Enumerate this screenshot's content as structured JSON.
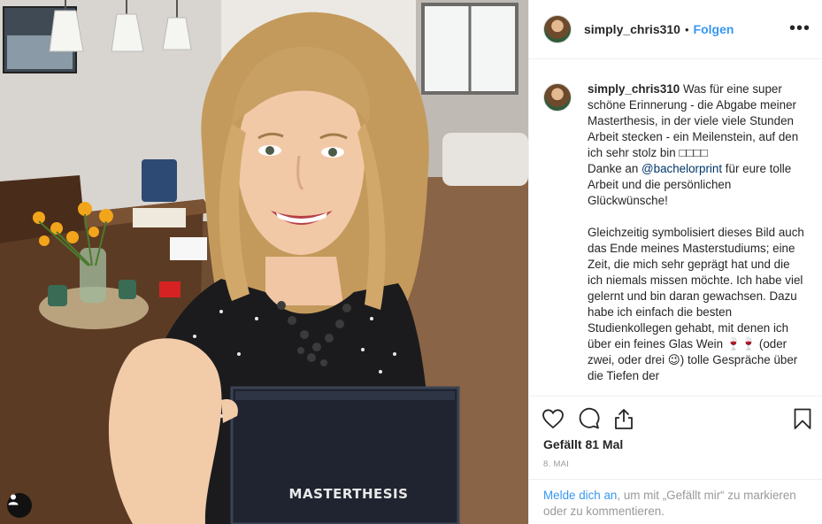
{
  "photo": {
    "book_label": "MASTERTHESIS",
    "user_tag_icon": "person-icon"
  },
  "header": {
    "username": "simply_chris310",
    "separator": "•",
    "follow_label": "Folgen",
    "more_icon": "more-options-icon"
  },
  "caption": {
    "username": "simply_chris310",
    "line1": " Was für eine super schöne Erinnerung - die Abgabe meiner Masterthesis, in der viele viele Stunden Arbeit stecken - ein Meilenstein, auf den ich sehr stolz bin □□□□",
    "thanks_prefix": "Danke an ",
    "mention": "@bachelorprint",
    "thanks_suffix": " für eure tolle Arbeit und die persönlichen Glückwünsche!",
    "paragraph2": "Gleichzeitig symbolisiert dieses Bild auch das Ende meines Masterstudiums; eine Zeit, die mich sehr geprägt hat und die ich niemals missen möchte. Ich habe viel gelernt und bin daran gewachsen. Dazu habe ich einfach die besten Studienkollegen gehabt, mit denen ich über ein feines Glas Wein 🍷🍷 (oder zwei, oder drei 😉) tolle Gespräche über die Tiefen der"
  },
  "actions": {
    "like_icon": "heart-icon",
    "comment_icon": "comment-icon",
    "share_icon": "share-icon",
    "save_icon": "bookmark-icon",
    "likes_text": "Gefällt 81 Mal",
    "date_text": "8. Mai"
  },
  "login": {
    "link_text": "Melde dich an",
    "rest_text": ", um mit „Gefällt mir“ zu markieren oder zu kommentieren."
  },
  "colors": {
    "link_blue": "#3897f0",
    "mention_blue": "#003569",
    "text": "#262626",
    "muted": "#999999",
    "divider": "#efefef"
  }
}
